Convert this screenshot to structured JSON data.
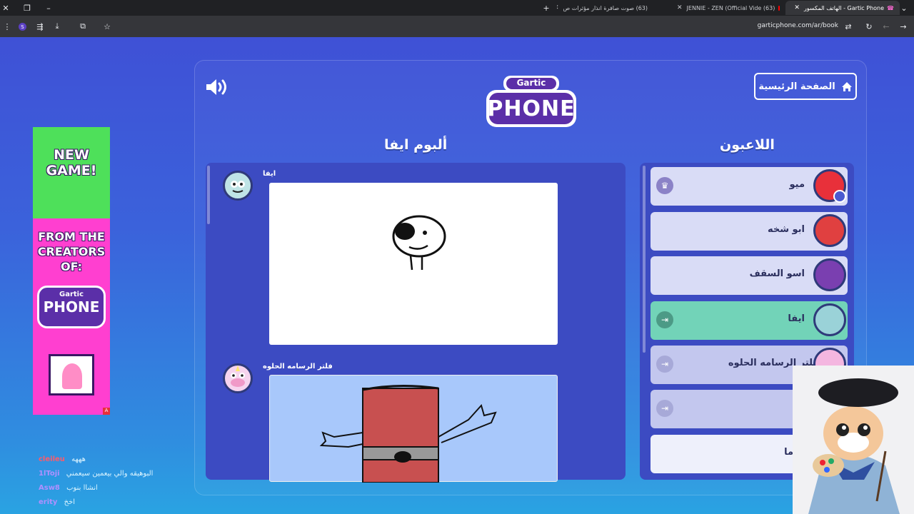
{
  "browser": {
    "tabs": [
      {
        "title": "Gartic Phone - الهاتف المكسور",
        "active": true
      },
      {
        "title": "(63) JENNIE - ZEN (Official Vide",
        "youtube": true
      },
      {
        "title": "(63) صوت صافرة انذار مؤثرات ص",
        "youtube": true
      }
    ],
    "url": "garticphone.com/ar/book"
  },
  "header": {
    "home_label": "الصفحة الرئيسية",
    "logo_top": "Gartic",
    "logo_bottom": "PHONE"
  },
  "album": {
    "title": "ألبوم ايفا",
    "entries": [
      {
        "author": "ايفا"
      },
      {
        "author": "فلتر الرسامه الحلوه"
      }
    ]
  },
  "players": {
    "title": "اللاعبون",
    "list": [
      {
        "name": "ميو",
        "status": "host",
        "color": "#e8303a"
      },
      {
        "name": "ابو شخه",
        "status": "",
        "color": "#e04040"
      },
      {
        "name": "اسو السقف",
        "status": "",
        "color": "#7a3fb0"
      },
      {
        "name": "ايفا",
        "status": "active",
        "color": "#9ad2d8"
      },
      {
        "name": "فلتر الرسامه الحلوه",
        "status": "",
        "color": "#f4b6e0"
      },
      {
        "name": "",
        "status": "",
        "color": "#c3c7ee"
      },
      {
        "name": "ما",
        "status": "",
        "color": "#ffffff"
      }
    ]
  },
  "ad": {
    "line1": "NEW",
    "line2": "GAME!",
    "line3": "FROM THE",
    "line4": "CREATORS",
    "line5": "OF:",
    "logo_top": "Gartic",
    "logo_bottom": "PHONE"
  },
  "chat": [
    {
      "user": "cleileu",
      "message": "هههه",
      "color": "#ff5a6a"
    },
    {
      "user": "1lToji",
      "message": "البوهيقه والي بيعمين سيعمني",
      "color": "#b090ff"
    },
    {
      "user": "Asw8",
      "message": "انشاا بنوب",
      "color": "#b090ff"
    },
    {
      "user": "erity",
      "message": "اخخ",
      "color": "#b090ff"
    }
  ]
}
